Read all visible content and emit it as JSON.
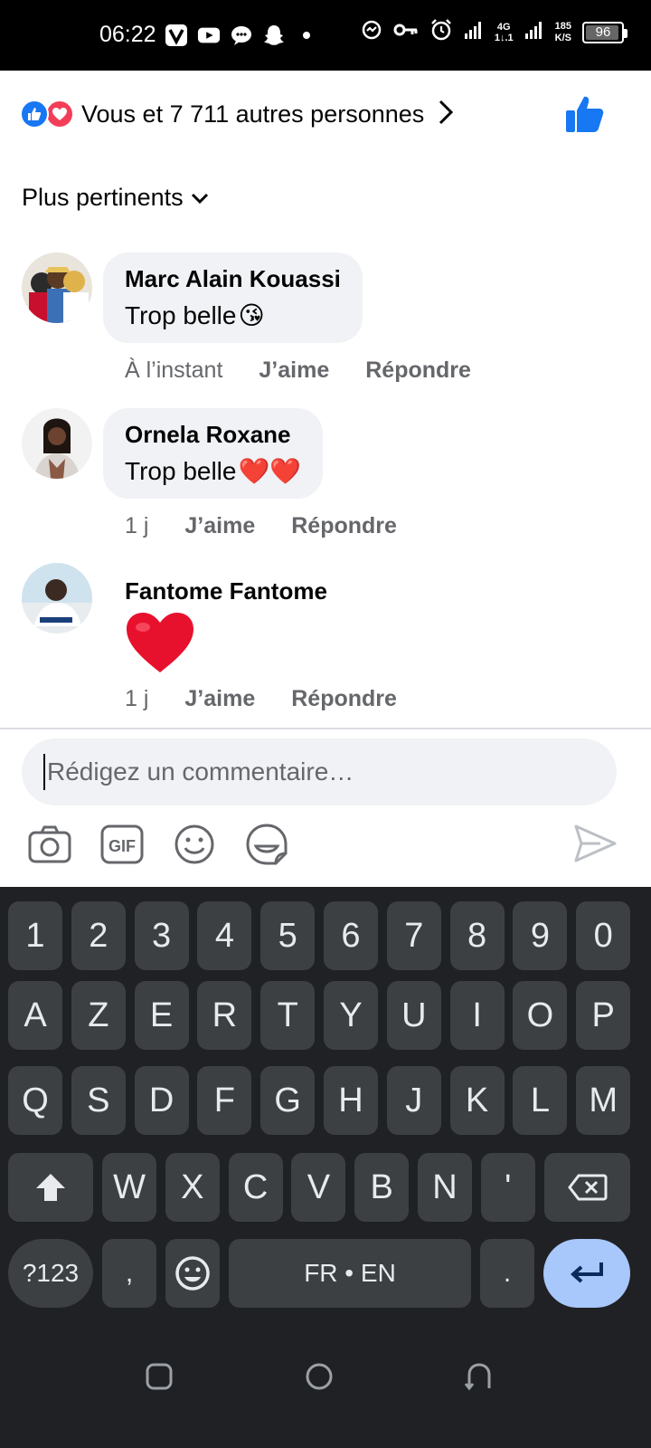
{
  "status_bar": {
    "time": "06:22",
    "network_top": "4G",
    "network_bottom": "1↓.1",
    "speed_top": "185",
    "speed_bottom": "K/S",
    "battery": "96"
  },
  "reactions": {
    "summary": "Vous et 7 711 autres personnes",
    "like_color": "#1877f2",
    "love_color": "#f33e58"
  },
  "sort": {
    "label": "Plus pertinents"
  },
  "comments": [
    {
      "name": "Marc Alain Kouassi",
      "text": "Trop belle",
      "emoji": "😘",
      "time": "À l’instant",
      "like": "J’aime",
      "reply": "Répondre"
    },
    {
      "name": "Ornela Roxane",
      "text": "Trop belle ",
      "emoji": "❤️❤️",
      "time": "1 j",
      "like": "J’aime",
      "reply": "Répondre"
    },
    {
      "name": "Fantome Fantome",
      "text": "",
      "emoji": "❤️",
      "time": "1 j",
      "like": "J’aime",
      "reply": "Répondre"
    }
  ],
  "composer": {
    "placeholder": "Rédigez un commentaire…",
    "tools": [
      "camera-icon",
      "gif-icon",
      "emoji-icon",
      "sticker-icon"
    ]
  },
  "keyboard": {
    "row_numbers": [
      "1",
      "2",
      "3",
      "4",
      "5",
      "6",
      "7",
      "8",
      "9",
      "0"
    ],
    "row1": [
      "A",
      "Z",
      "E",
      "R",
      "T",
      "Y",
      "U",
      "I",
      "O",
      "P"
    ],
    "row2": [
      "Q",
      "S",
      "D",
      "F",
      "G",
      "H",
      "J",
      "K",
      "L",
      "M"
    ],
    "row3": [
      "W",
      "X",
      "C",
      "V",
      "B",
      "N",
      "'"
    ],
    "symbols_key": "?123",
    "comma_key": ",",
    "space_label": "FR • EN",
    "period_key": "."
  }
}
